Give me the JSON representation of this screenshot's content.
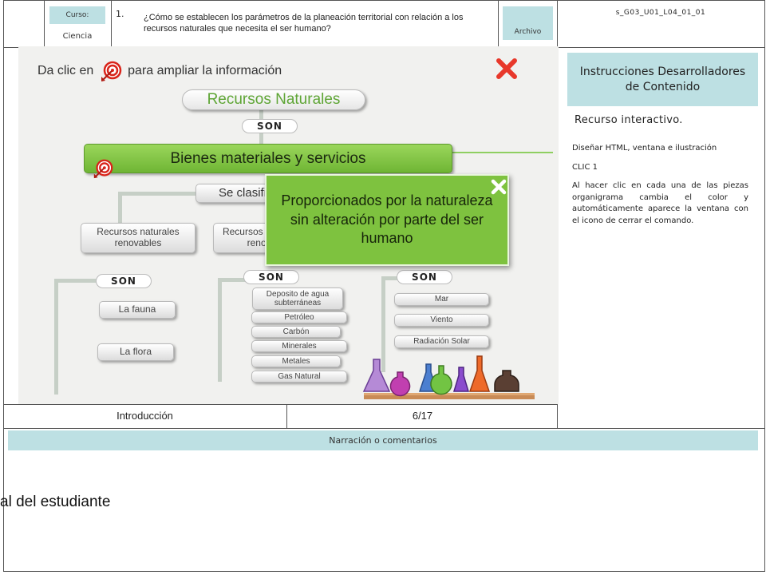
{
  "header": {
    "curso_label": "Curso:",
    "curso_value": "Ciencia",
    "number": "1.",
    "question": "¿Cómo se establecen los parámetros de la planeación territorial con relación a los recursos naturales que necesita el ser humano?",
    "archivo_label": "Archivo",
    "file_code": "s_G03_U01_L04_01_01"
  },
  "interactive": {
    "instruction_prefix": "Da clic en",
    "instruction_suffix": "para ampliar la información",
    "root_title": "Recursos Naturales",
    "son_label": "SON",
    "main_node": "Bienes materiales y servicios",
    "classify_label": "Se clasifican en",
    "categories": [
      "Recursos naturales renovables",
      "Recursos naturales no renovables"
    ],
    "renewables": [
      "La fauna",
      "La flora"
    ],
    "nonrenewables": [
      "Deposito de agua subterráneas",
      "Petróleo",
      "Carbón",
      "Minerales",
      "Metales",
      "Gas Natural"
    ],
    "inexhaustible": [
      "Mar",
      "Viento",
      "Radiación Solar"
    ],
    "popup_text": "Proporcionados por la naturaleza sin alteración por parte del ser humano",
    "colors": {
      "green": "#7ec23f",
      "red": "#d9241a",
      "stage": "#f1f1ef"
    }
  },
  "footer_nav": {
    "section": "Introducción",
    "page": "6/17"
  },
  "instructions": {
    "title": "Instrucciones Desarrolladores de Contenido",
    "resource": "Recurso interactivo.",
    "line1": "Diseñar HTML, ventana e ilustración",
    "line2": "CLIC 1",
    "line3": "Al hacer clic en cada una de las piezas organigrama cambia el color y automáticamente aparece la ventana con el icono de cerrar el comando."
  },
  "narration": {
    "label": "Narración o comentarios",
    "text": "al del estudiante"
  }
}
